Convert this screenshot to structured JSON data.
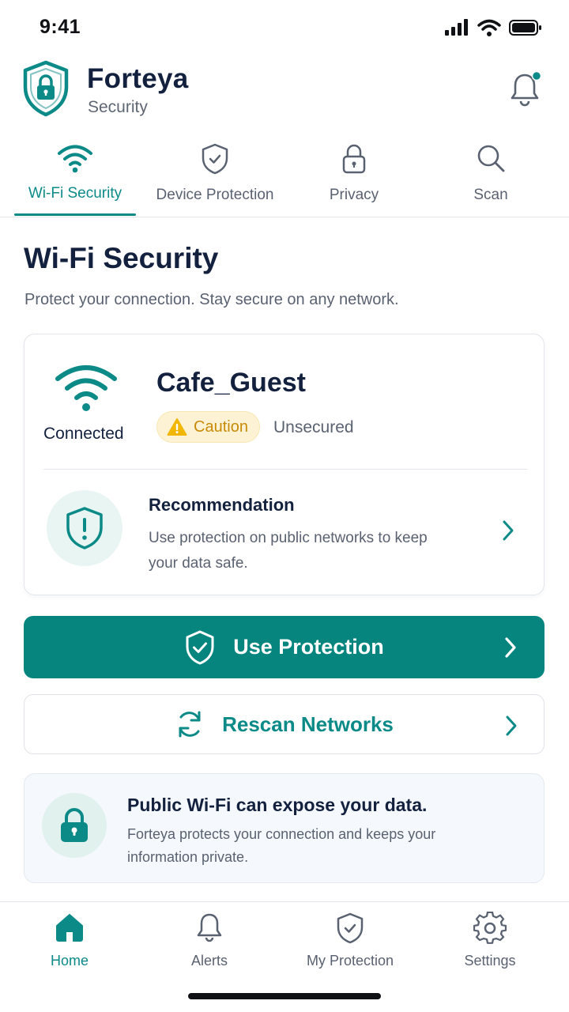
{
  "status_bar": {
    "time": "9:41"
  },
  "header": {
    "brand_name": "Forteya",
    "brand_subtitle": "Security",
    "notification_dot_color": "#0b8a87"
  },
  "tabs": [
    {
      "label": "Wi-Fi Security",
      "icon": "wifi-icon",
      "active": true
    },
    {
      "label": "Device Protection",
      "icon": "shield-check-icon",
      "active": false
    },
    {
      "label": "Privacy",
      "icon": "lock-icon",
      "active": false
    },
    {
      "label": "Scan",
      "icon": "search-icon",
      "active": false
    }
  ],
  "page": {
    "title": "Wi-Fi Security",
    "subtitle": "Protect your connection. Stay secure on any network."
  },
  "network_card": {
    "status": "Connected",
    "network_name": "Cafe_Guest",
    "badge_label": "Caution",
    "security_label": "Unsecured",
    "recommendation_title": "Recommendation",
    "recommendation_body": "Use protection on public networks to keep your data safe."
  },
  "actions": {
    "primary_label": "Use Protection",
    "secondary_label": "Rescan Networks"
  },
  "info_card": {
    "title": "Public Wi-Fi can expose your data.",
    "body": "Forteya protects your connection and keeps your information private."
  },
  "bottom_nav": [
    {
      "label": "Home",
      "icon": "home-icon",
      "active": true
    },
    {
      "label": "Alerts",
      "icon": "bell-icon",
      "active": false
    },
    {
      "label": "My Protection",
      "icon": "shield-check-icon",
      "active": false
    },
    {
      "label": "Settings",
      "icon": "gear-icon",
      "active": false
    }
  ],
  "colors": {
    "accent": "#06857f",
    "caution": "#f2b705",
    "text_dark": "#13213f",
    "text_muted": "#5a6170"
  }
}
